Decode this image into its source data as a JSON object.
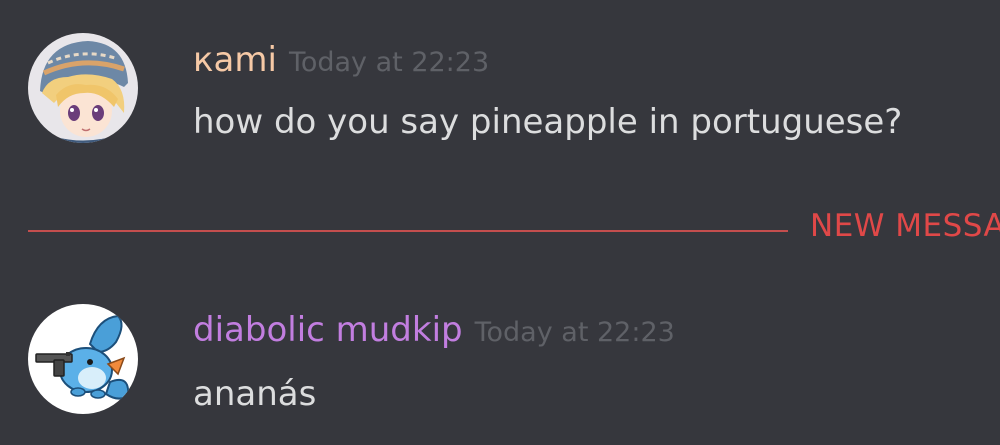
{
  "messages": [
    {
      "username": "кami",
      "username_color": "#f6c9a6",
      "timestamp": "Today at 22:23",
      "content": "how do you say pineapple in portuguese?",
      "avatar_icon": "anime-character-avatar"
    },
    {
      "username": "diabolic mudkip",
      "username_color": "#c27ee0",
      "timestamp": "Today at 22:23",
      "content": "ananás",
      "avatar_icon": "mudkip-with-gun-avatar"
    }
  ],
  "divider": {
    "label": "NEW MESSA",
    "color": "#e04848"
  },
  "colors": {
    "background": "#36373d",
    "text": "#dcddde",
    "timestamp": "#5f6167"
  }
}
